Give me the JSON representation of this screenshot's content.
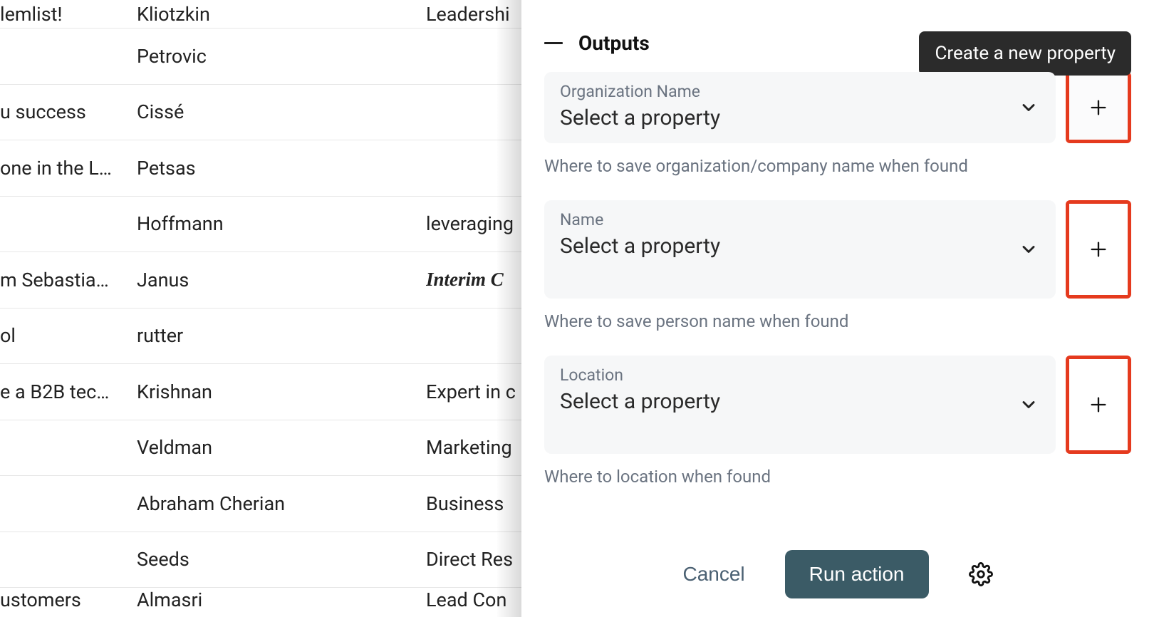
{
  "table": {
    "rows": [
      {
        "c1": " lemlist!",
        "c2": "Kliotzkin",
        "c3": "Leadershi",
        "c3_italic": false
      },
      {
        "c1": "",
        "c2": "Petrovic",
        "c3": "",
        "c3_italic": false
      },
      {
        "c1": "u success",
        "c2": "Cissé",
        "c3": "",
        "c3_italic": false
      },
      {
        "c1": "one in the L…",
        "c2": "Petsas",
        "c3": "",
        "c3_italic": false
      },
      {
        "c1": "",
        "c2": "Hoffmann",
        "c3": "leveraging",
        "c3_italic": false
      },
      {
        "c1": "m Sebastia…",
        "c2": "Janus",
        "c3": "Interim C",
        "c3_italic": true
      },
      {
        "c1": "ol",
        "c2": "rutter",
        "c3": "",
        "c3_italic": false
      },
      {
        "c1": "e a B2B tec…",
        "c2": "Krishnan",
        "c3": "Expert in c",
        "c3_italic": false
      },
      {
        "c1": "",
        "c2": "Veldman",
        "c3": "Marketing",
        "c3_italic": false
      },
      {
        "c1": "",
        "c2": "Abraham Cherian",
        "c3": "Business ",
        "c3_italic": false
      },
      {
        "c1": "",
        "c2": "Seeds",
        "c3": "Direct Res",
        "c3_italic": false
      },
      {
        "c1": "ustomers",
        "c2": "Almasri",
        "c3": "Lead Con",
        "c3_italic": false
      }
    ]
  },
  "panel": {
    "title": "Outputs",
    "tooltip": "Create a new property",
    "outputs": [
      {
        "label": "Organization Name",
        "placeholder": "Select a property",
        "helper": "Where to save organization/company name when found",
        "add_bg_light": true
      },
      {
        "label": "Name",
        "placeholder": "Select a property",
        "helper": "Where to save person name when found",
        "add_bg_light": false
      },
      {
        "label": "Location",
        "placeholder": "Select a property",
        "helper": "Where to location when found",
        "add_bg_light": false
      }
    ],
    "footer": {
      "cancel": "Cancel",
      "run": "Run action"
    }
  }
}
